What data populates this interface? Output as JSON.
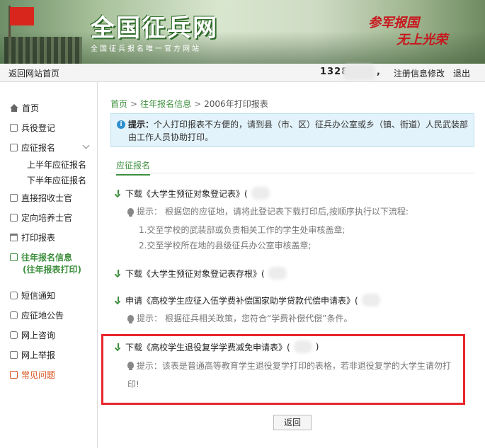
{
  "banner": {
    "site_title": "全国征兵网",
    "site_subtitle": "全国征兵报名唯一官方网站",
    "slogan_1": "参军报国",
    "slogan_2": "无上光荣"
  },
  "topbar": {
    "back_home": "返回网站首页",
    "user_prefix": "1328",
    "comma": ",",
    "modify": "注册信息修改",
    "logout": "退出"
  },
  "sidebar": {
    "home": "首页",
    "registration": "兵役登记",
    "enlist": "应征报名",
    "enlist_first_half": "上半年应征报名",
    "enlist_second_half": "下半年应征报名",
    "direct_recruit": "直接招收士官",
    "directed_training": "定向培养士官",
    "print_form": "打印报表",
    "past_info_1": "往年报名信息",
    "past_info_2": "(往年报表打印)",
    "sms": "短信通知",
    "notice": "应征地公告",
    "consult": "网上咨询",
    "report": "网上举报",
    "faq": "常见问题"
  },
  "breadcrumb": {
    "home": "首页",
    "past": "往年报名信息",
    "current": "2006年打印报表",
    "sep": ">"
  },
  "tip": {
    "label": "提示：",
    "text": "个人打印报表不方便的，请到县（市、区）征兵办公室或乡（镇、街道）人民武装部由工作人员协助打印。"
  },
  "tab": "应征报名",
  "items": [
    {
      "title": "下载《大学生预征对象登记表》(",
      "hint_label": "提示：",
      "hint": "根据您的应征地，请将此登记表下载打印后,按顺序执行以下流程:",
      "steps": [
        "1.交至学校的武装部或负责相关工作的学生处审核盖章;",
        "2.交至学校所在地的县级征兵办公室审核盖章;"
      ]
    },
    {
      "title": "下载《大学生预征对象登记表存根》(",
      "hint_label": "",
      "hint": "",
      "steps": []
    },
    {
      "title": "申请《高校学生应征入伍学费补偿国家助学贷款代偿申请表》(",
      "hint_label": "提示：",
      "hint": "根据征兵相关政策，您符合“学费补偿代偿”条件。",
      "steps": []
    },
    {
      "title": "下载《高校学生退役复学学费减免申请表》(",
      "title_end": ")",
      "hint_label": "提示：",
      "hint": "该表是普通高等教育学生退役复学打印的表格，若非退役复学的大学生请勿打印!",
      "steps": []
    }
  ],
  "back_button": "返回"
}
